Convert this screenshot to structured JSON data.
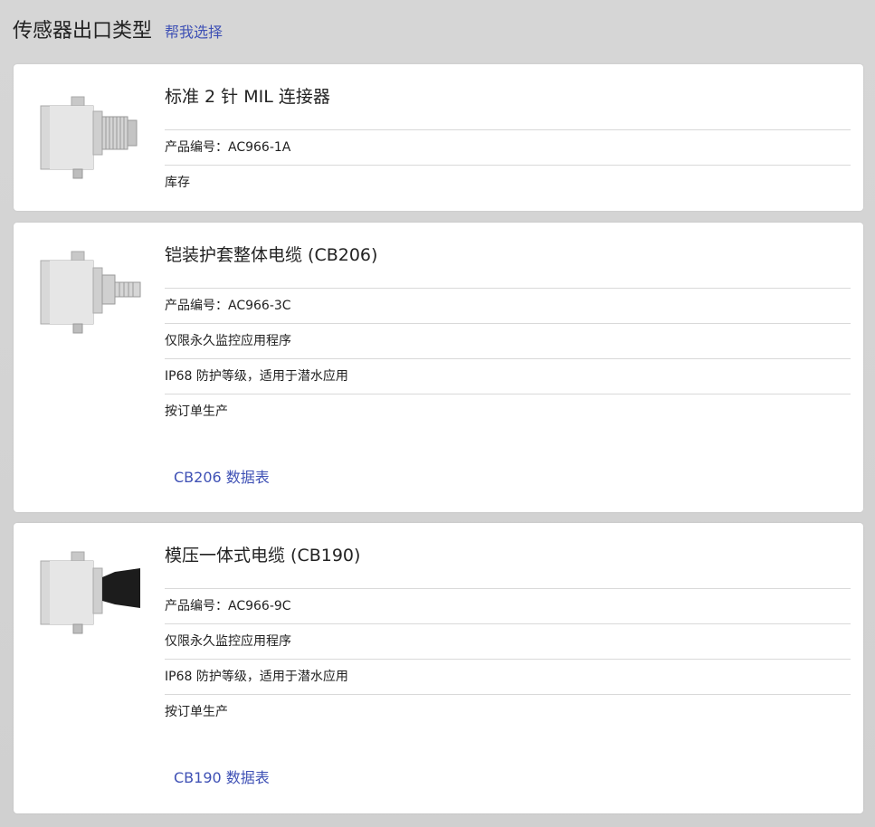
{
  "header": {
    "title": "传感器出口类型",
    "help_link": "帮我选择"
  },
  "cards": [
    {
      "name": "标准 2 针 MIL 连接器",
      "rows": [
        "产品编号：AC966-1A",
        "库存"
      ],
      "datasheet": ""
    },
    {
      "name": "铠装护套整体电缆 (CB206)",
      "rows": [
        "产品编号：AC966-3C",
        "仅限永久监控应用程序",
        "IP68 防护等级，适用于潜水应用",
        "按订单生产"
      ],
      "datasheet": "CB206 数据表"
    },
    {
      "name": "模压一体式电缆 (CB190)",
      "rows": [
        "产品编号：AC966-9C",
        "仅限永久监控应用程序",
        "IP68 防护等级，适用于潜水应用",
        "按订单生产"
      ],
      "datasheet": "CB190 数据表"
    }
  ]
}
